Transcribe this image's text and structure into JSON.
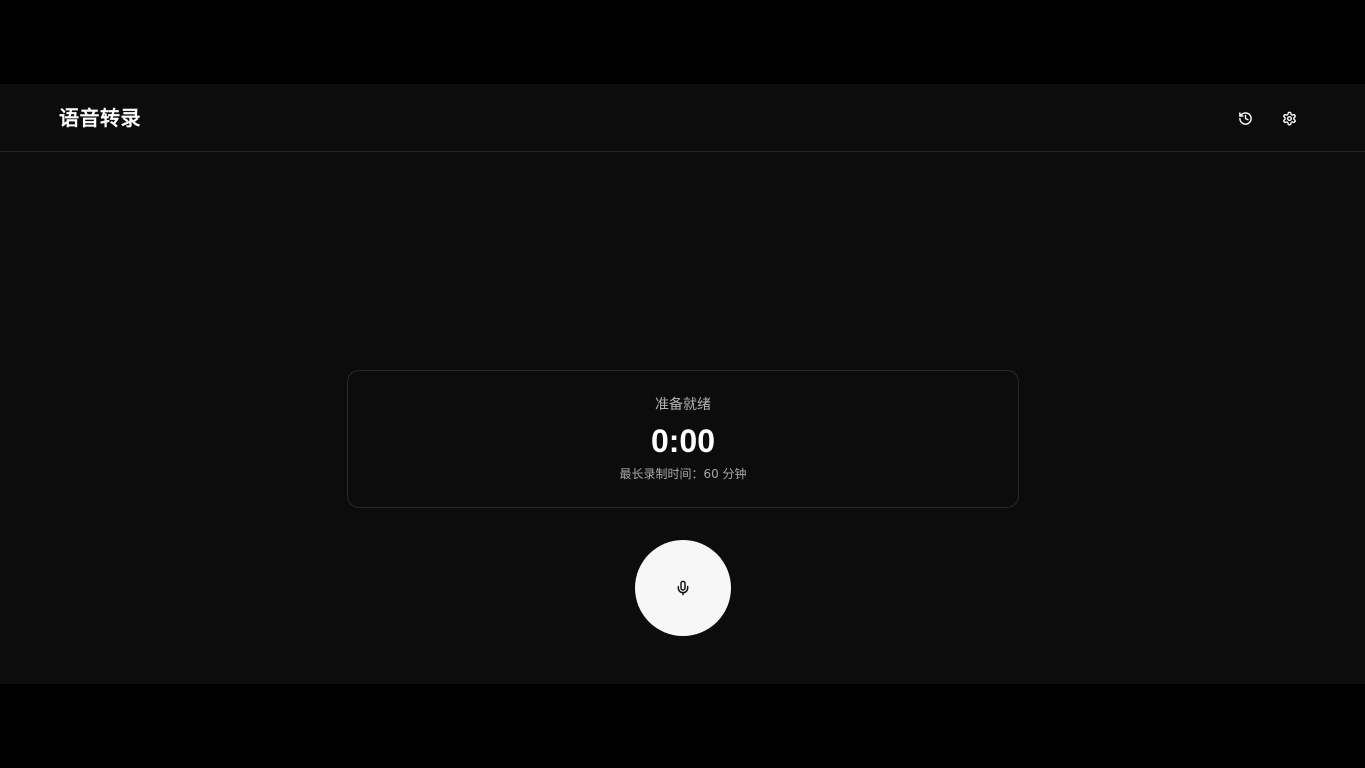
{
  "header": {
    "title": "语音转录",
    "history_icon": "history-icon",
    "settings_icon": "gear-icon"
  },
  "status": {
    "state": "准备就绪",
    "timer": "0:00",
    "max_duration": "最长录制时间：60 分钟"
  },
  "record": {
    "icon": "microphone-icon"
  },
  "colors": {
    "background": "#0c0c0c",
    "outer": "#000000",
    "text": "#ffffff",
    "muted": "#b3b3b3",
    "border": "#2a2a2a",
    "record_button": "#f7f7f7"
  }
}
